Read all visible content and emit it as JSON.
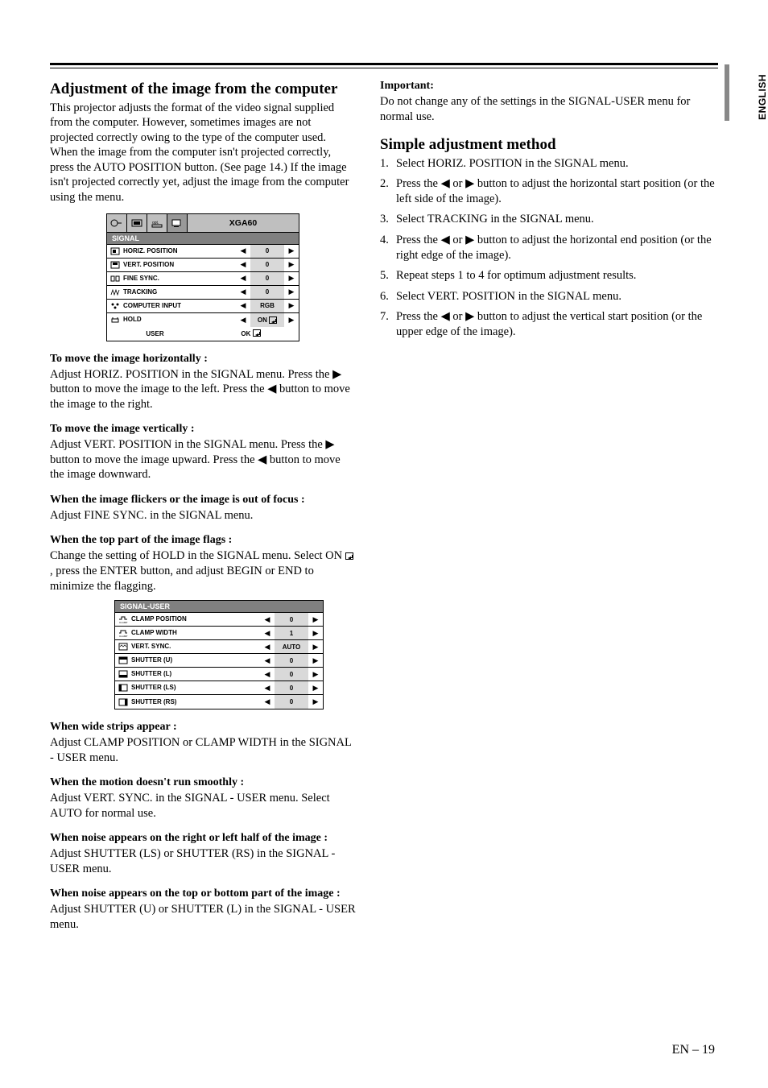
{
  "side_label": "ENGLISH",
  "page_number": "EN – 19",
  "left": {
    "h_main": "Adjustment of the image from the computer",
    "intro": "This projector adjusts the format of the video signal supplied from the computer. However, sometimes images are not projected correctly owing to the type of the computer used. When the image from the computer isn't projected correctly, press the AUTO POSITION button. (See page 14.) If the image isn't projected correctly yet, adjust the image from the computer using the menu.",
    "menu1": {
      "title": "XGA60",
      "section": "SIGNAL",
      "rows": [
        {
          "label": "HORIZ. POSITION",
          "value": "0"
        },
        {
          "label": "VERT. POSITION",
          "value": "0"
        },
        {
          "label": "FINE SYNC.",
          "value": "0"
        },
        {
          "label": "TRACKING",
          "value": "0"
        },
        {
          "label": "COMPUTER INPUT",
          "value": "RGB"
        },
        {
          "label": "HOLD",
          "value": "ON"
        }
      ],
      "user_label": "USER",
      "user_value": "OK"
    },
    "h_move_h": "To move the image horizontally :",
    "move_h_body": "Adjust HORIZ. POSITION in the SIGNAL menu. Press the ▶ button to move the image to the left. Press the ◀ button to move the image to the right.",
    "h_move_v": "To move the image vertically :",
    "move_v_body": "Adjust VERT. POSITION in the SIGNAL menu. Press the ▶ button to move the image upward. Press the ◀ button to move the image downward.",
    "h_flicker": "When the image flickers or the image is out of focus :",
    "flicker_body": "Adjust FINE SYNC. in the SIGNAL menu.",
    "h_flags": "When the top part of the image flags :",
    "flags_body_pre": "Change the setting of HOLD in the SIGNAL menu. Select ON ",
    "flags_body_post": ", press the ENTER button, and adjust BEGIN or END to minimize the flagging.",
    "menu2": {
      "section": "SIGNAL-USER",
      "rows": [
        {
          "label": "CLAMP POSITION",
          "value": "0"
        },
        {
          "label": "CLAMP WIDTH",
          "value": "1"
        },
        {
          "label": "VERT. SYNC.",
          "value": "AUTO"
        },
        {
          "label": "SHUTTER (U)",
          "value": "0"
        },
        {
          "label": "SHUTTER (L)",
          "value": "0"
        },
        {
          "label": "SHUTTER (LS)",
          "value": "0"
        },
        {
          "label": "SHUTTER (RS)",
          "value": "0"
        }
      ]
    },
    "h_strips": "When wide strips appear :",
    "strips_body": "Adjust CLAMP POSITION or CLAMP WIDTH in the SIGNAL - USER menu.",
    "h_motion": "When the motion doesn't run smoothly :",
    "motion_body": "Adjust VERT. SYNC. in the SIGNAL - USER menu. Select AUTO for normal use.",
    "h_noise_lr": "When noise appears on the right or left half of the image :",
    "noise_lr_body": "Adjust SHUTTER (LS) or SHUTTER (RS) in the SIGNAL - USER menu.",
    "h_noise_tb": "When noise appears on the top or bottom part of the image :",
    "noise_tb_body": "Adjust SHUTTER (U) or SHUTTER (L) in the SIGNAL - USER menu."
  },
  "right": {
    "h_important": "Important:",
    "important_body": "Do not change any of the settings in the SIGNAL-USER menu for normal use.",
    "h_simple": "Simple adjustment method",
    "steps": [
      {
        "n": "1.",
        "body": "Select HORIZ. POSITION in the SIGNAL menu."
      },
      {
        "n": "2.",
        "body_pre": "Press the ",
        "body_post": " button to adjust the horizontal start position (or the left side of the image)."
      },
      {
        "n": "3.",
        "body": "Select TRACKING in the SIGNAL menu."
      },
      {
        "n": "4.",
        "body_pre": "Press the ",
        "body_post": " button to adjust the horizontal end position (or the right edge of the image)."
      },
      {
        "n": "5.",
        "body": "Repeat steps 1 to 4 for optimum adjustment results."
      },
      {
        "n": "6.",
        "body": "Select VERT. POSITION in the SIGNAL menu."
      },
      {
        "n": "7.",
        "body_pre": "Press the ",
        "body_post": " button to adjust the vertical start position (or the upper edge of the image)."
      }
    ],
    "or_text": " or "
  }
}
